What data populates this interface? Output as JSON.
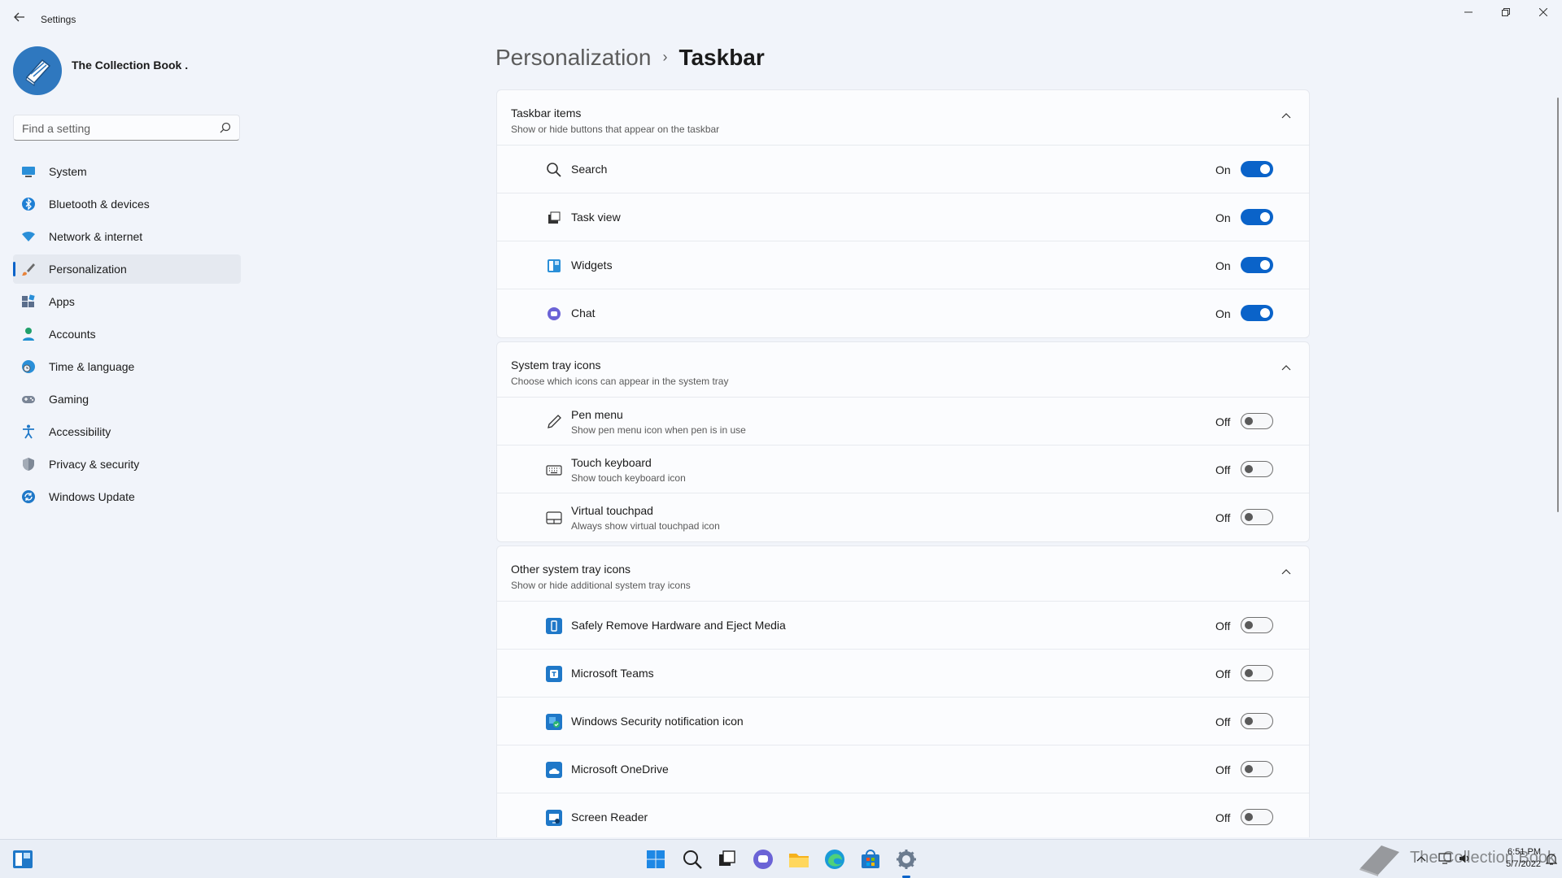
{
  "window": {
    "title": "Settings",
    "back_icon": "arrow-left-icon",
    "minimize_icon": "minimize-icon",
    "maximize_icon": "restore-icon",
    "close_icon": "close-icon"
  },
  "profile": {
    "name": "The Collection Book ."
  },
  "search": {
    "placeholder": "Find a setting"
  },
  "sidebar": {
    "items": [
      {
        "label": "System",
        "icon": "monitor-icon",
        "active": false
      },
      {
        "label": "Bluetooth & devices",
        "icon": "bluetooth-icon",
        "active": false
      },
      {
        "label": "Network & internet",
        "icon": "wifi-icon",
        "active": false
      },
      {
        "label": "Personalization",
        "icon": "brush-icon",
        "active": true
      },
      {
        "label": "Apps",
        "icon": "apps-icon",
        "active": false
      },
      {
        "label": "Accounts",
        "icon": "person-icon",
        "active": false
      },
      {
        "label": "Time & language",
        "icon": "globe-clock-icon",
        "active": false
      },
      {
        "label": "Gaming",
        "icon": "gamepad-icon",
        "active": false
      },
      {
        "label": "Accessibility",
        "icon": "accessibility-icon",
        "active": false
      },
      {
        "label": "Privacy & security",
        "icon": "shield-icon",
        "active": false
      },
      {
        "label": "Windows Update",
        "icon": "update-icon",
        "active": false
      }
    ]
  },
  "breadcrumb": {
    "parent": "Personalization",
    "separator": "›",
    "current": "Taskbar"
  },
  "groups": [
    {
      "title": "Taskbar items",
      "subtitle": "Show or hide buttons that appear on the taskbar",
      "rows": [
        {
          "label": "Search",
          "state": "On",
          "on": true,
          "icon": "search-icon"
        },
        {
          "label": "Task view",
          "state": "On",
          "on": true,
          "icon": "task-view-icon"
        },
        {
          "label": "Widgets",
          "state": "On",
          "on": true,
          "icon": "widgets-icon"
        },
        {
          "label": "Chat",
          "state": "On",
          "on": true,
          "icon": "chat-icon"
        }
      ]
    },
    {
      "title": "System tray icons",
      "subtitle": "Choose which icons can appear in the system tray",
      "rows": [
        {
          "label": "Pen menu",
          "desc": "Show pen menu icon when pen is in use",
          "state": "Off",
          "on": false,
          "icon": "pen-icon"
        },
        {
          "label": "Touch keyboard",
          "desc": "Show touch keyboard icon",
          "state": "Off",
          "on": false,
          "icon": "keyboard-icon"
        },
        {
          "label": "Virtual touchpad",
          "desc": "Always show virtual touchpad icon",
          "state": "Off",
          "on": false,
          "icon": "touchpad-icon"
        }
      ]
    },
    {
      "title": "Other system tray icons",
      "subtitle": "Show or hide additional system tray icons",
      "rows": [
        {
          "label": "Safely Remove Hardware and Eject Media",
          "state": "Off",
          "on": false,
          "icon": "usb-icon"
        },
        {
          "label": "Microsoft Teams",
          "state": "Off",
          "on": false,
          "icon": "teams-icon"
        },
        {
          "label": "Windows Security notification icon",
          "state": "Off",
          "on": false,
          "icon": "security-icon"
        },
        {
          "label": "Microsoft OneDrive",
          "state": "Off",
          "on": false,
          "icon": "onedrive-icon"
        },
        {
          "label": "Screen Reader",
          "state": "Off",
          "on": false,
          "icon": "screen-reader-icon"
        }
      ]
    }
  ],
  "taskbar": {
    "apps": [
      "widgets-icon",
      "start-icon",
      "search-icon",
      "task-view-icon",
      "chat-icon",
      "file-explorer-icon",
      "edge-icon",
      "store-icon",
      "settings-icon"
    ],
    "time": "6:51 PM",
    "date": "5/7/2022"
  },
  "watermark": {
    "text": "The Collection Book"
  },
  "colors": {
    "accent": "#0a63c9",
    "background": "#f1f4fa",
    "card": "#fbfcfe"
  }
}
